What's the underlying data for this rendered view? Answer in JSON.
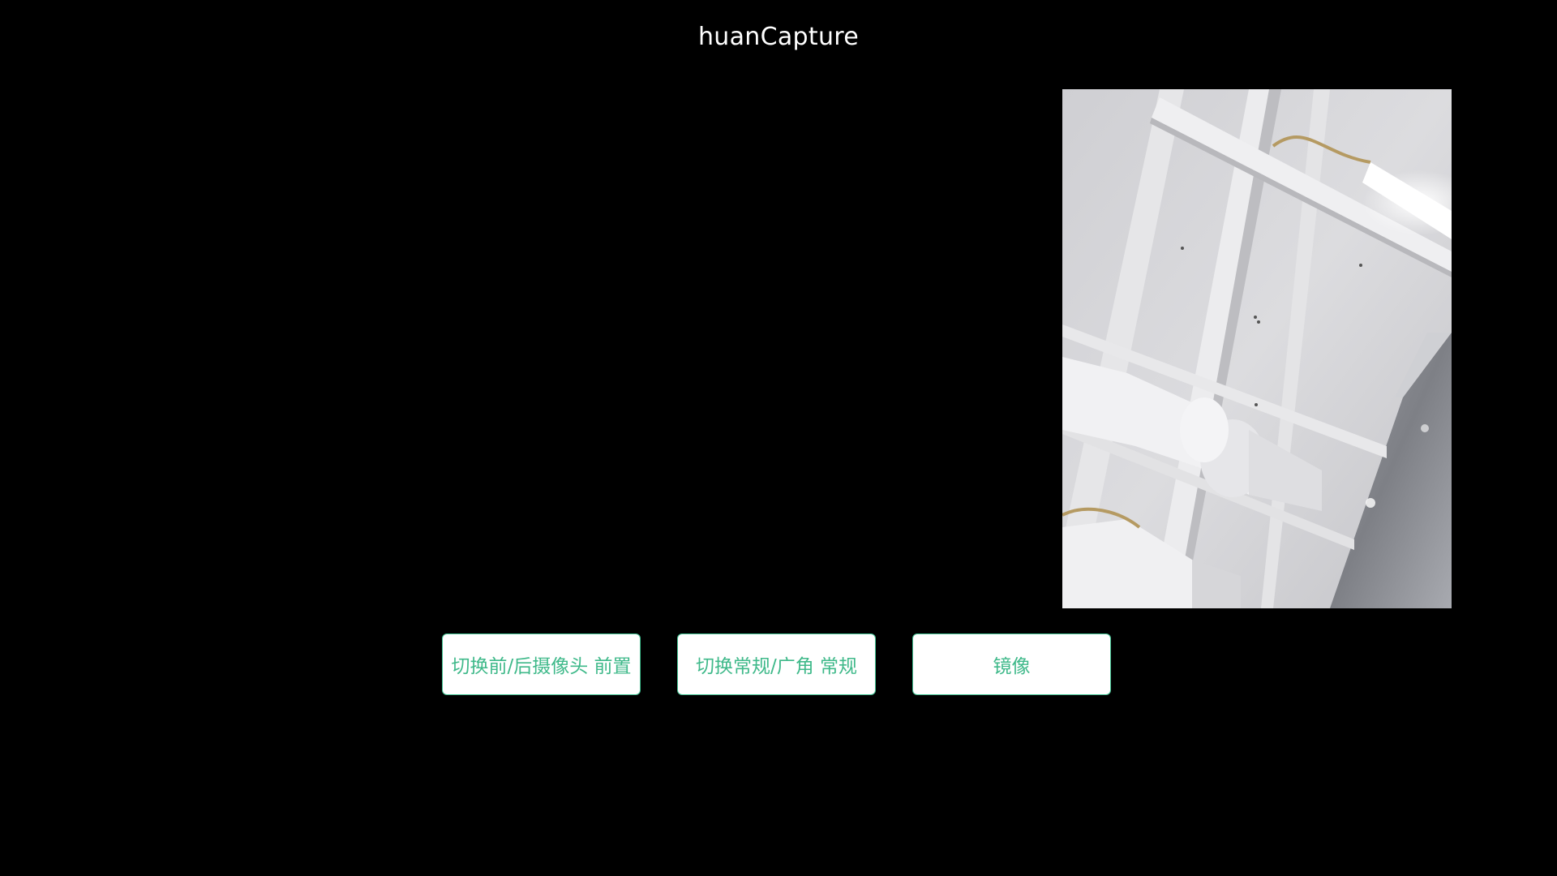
{
  "app": {
    "title": "huanCapture"
  },
  "preview": {
    "content": "camera-preview-ceiling-pipes"
  },
  "controls": {
    "switch_camera_label": "切换前/后摄像头  前置",
    "switch_lens_label": "切换常规/广角  常规",
    "mirror_label": "镜像"
  },
  "colors": {
    "background": "#000000",
    "title_text": "#ffffff",
    "button_bg": "#ffffff",
    "button_border": "#3fbf8f",
    "button_text": "#3fb98a"
  }
}
